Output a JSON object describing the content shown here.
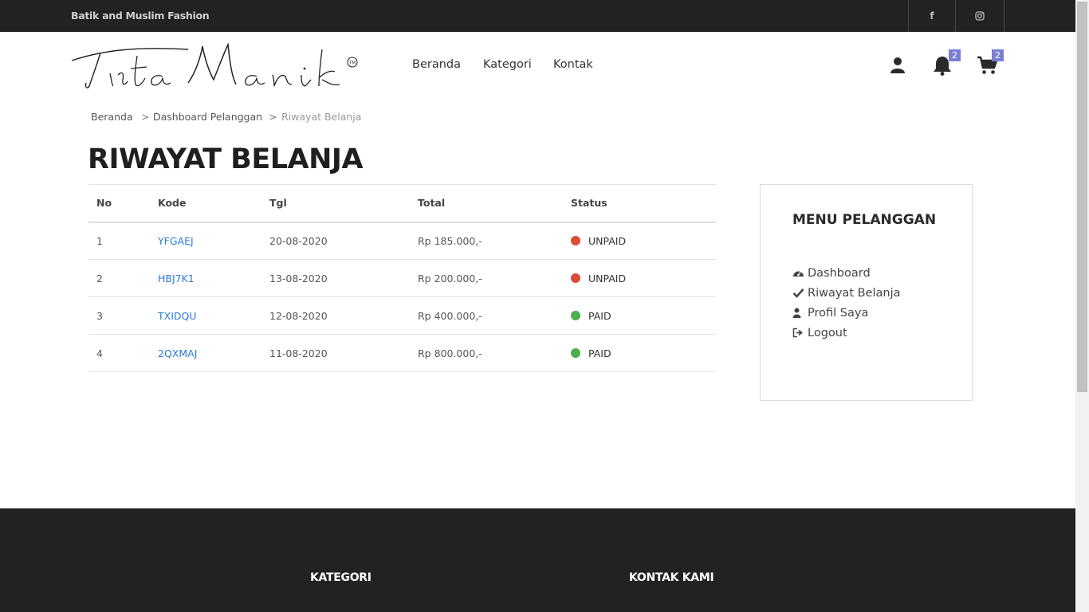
{
  "topbar": {
    "tagline": "Batik and Muslim Fashion",
    "social": [
      {
        "icon": "facebook-icon",
        "label": "f"
      },
      {
        "icon": "instagram-icon"
      }
    ]
  },
  "header": {
    "logo_text": "Tirta Manik",
    "logo_mark": "TM",
    "nav": [
      "Beranda",
      "Kategori",
      "Kontak"
    ],
    "icons": [
      "user-icon",
      "bell-icon",
      "cart-icon"
    ],
    "notification_count": "2",
    "cart_count": "2"
  },
  "breadcrumb": {
    "items": [
      "Beranda",
      "Dashboard Pelanggan",
      "Riwayat Belanja"
    ],
    "separator": ">"
  },
  "page_title": "RIWAYAT BELANJA",
  "orders": {
    "columns": [
      "No",
      "Kode",
      "Tgl",
      "Total",
      "Status"
    ],
    "rows": [
      {
        "no": "1",
        "kode": "YFGAEJ",
        "tgl": "20-08-2020",
        "total": "Rp 185.000,-",
        "status": "UNPAID",
        "status_color": "#dd4b39"
      },
      {
        "no": "2",
        "kode": "HBJ7K1",
        "tgl": "13-08-2020",
        "total": "Rp 200.000,-",
        "status": "UNPAID",
        "status_color": "#dd4b39"
      },
      {
        "no": "3",
        "kode": "TXIDQU",
        "tgl": "12-08-2020",
        "total": "Rp 400.000,-",
        "status": "PAID",
        "status_color": "#4cae4c"
      },
      {
        "no": "4",
        "kode": "2QXMAJ",
        "tgl": "11-08-2020",
        "total": "Rp 800.000,-",
        "status": "PAID",
        "status_color": "#4cae4c"
      }
    ]
  },
  "sidebar": {
    "title": "MENU PELANGGAN",
    "items": [
      {
        "label": "Dashboard",
        "icon": "dashboard-icon"
      },
      {
        "label": "Riwayat Belanja",
        "icon": "check-icon"
      },
      {
        "label": "Profil Saya",
        "icon": "user-icon"
      },
      {
        "label": "Logout",
        "icon": "logout-icon"
      }
    ]
  },
  "footer": {
    "headings": [
      "KATEGORI",
      "KONTAK KAMI"
    ]
  },
  "colors": {
    "topbar_bg": "#222222",
    "link": "#2b7bd8",
    "badge": "#7b7fd4",
    "unpaid": "#dd4b39",
    "paid": "#4cae4c"
  }
}
